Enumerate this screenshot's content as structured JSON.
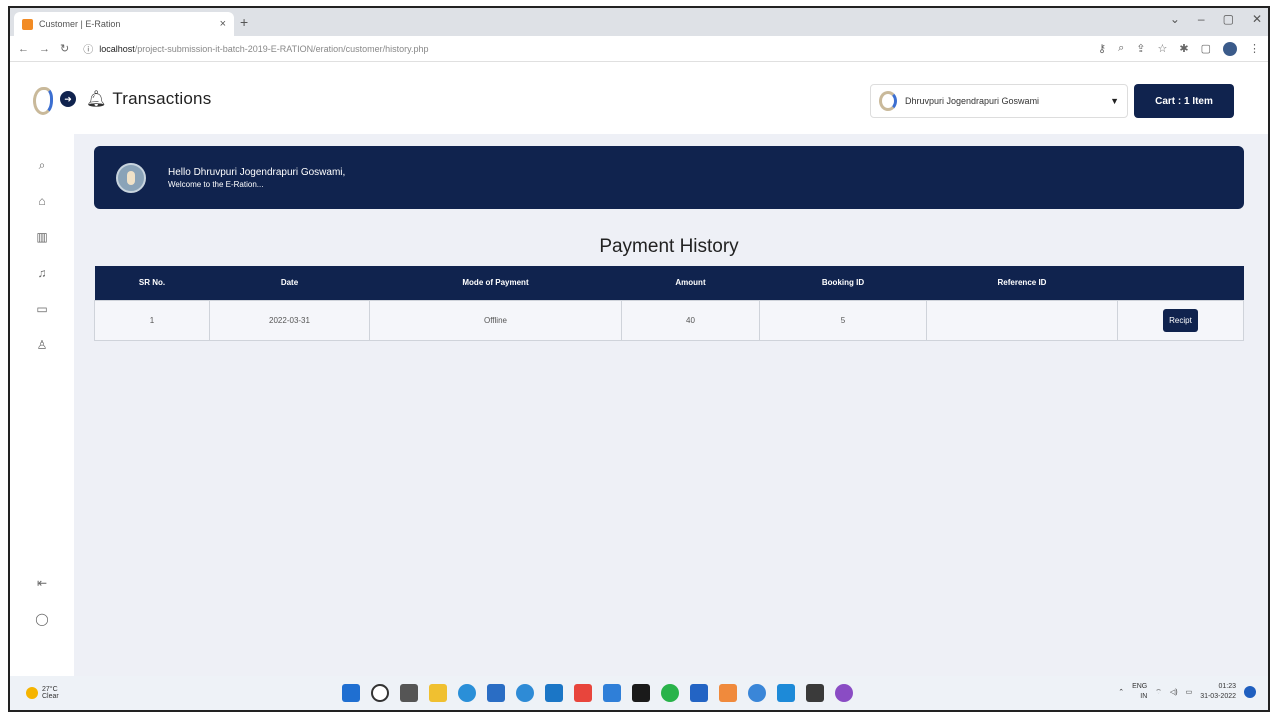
{
  "browser": {
    "tab_title": "Customer | E-Ration",
    "tab_close": "×",
    "new_tab": "+",
    "url_host": "localhost",
    "url_path": "/project-submission-it-batch-2019-E-RATION/eration/customer/history.php",
    "window_controls": [
      "⌄",
      "–",
      "▢",
      "✕"
    ]
  },
  "header": {
    "title": "Transactions",
    "user_name": "Dhruvpuri Jogendrapuri Goswami",
    "cart_label": "Cart : 1 Item"
  },
  "banner": {
    "greeting": "Hello Dhruvpuri Jogendrapuri Goswami,",
    "welcome": "Welcome to the E-Ration..."
  },
  "payment_history": {
    "title": "Payment History",
    "columns": [
      "SR No.",
      "Date",
      "Mode of Payment",
      "Amount",
      "Booking ID",
      "Reference ID",
      ""
    ],
    "rows": [
      {
        "sr": "1",
        "date": "2022-03-31",
        "mode": "Offline",
        "amount": "40",
        "booking_id": "5",
        "reference_id": "",
        "action": "Recipt"
      }
    ]
  },
  "taskbar": {
    "weather_temp": "27°C",
    "weather_desc": "Clear",
    "lang": "ENG",
    "region": "IN",
    "time": "01:23",
    "date": "31-03-2022"
  }
}
